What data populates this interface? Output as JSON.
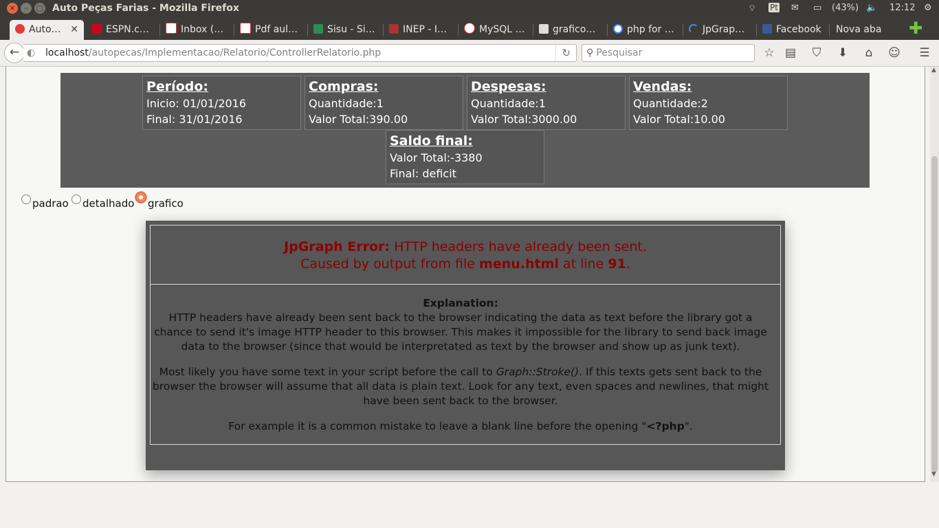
{
  "os": {
    "window_title": "Auto Peças Farias - Mozilla Firefox",
    "keyboard": "Pt",
    "battery": "(43%)",
    "clock": "12:12"
  },
  "tabs": [
    {
      "label": "Auto…",
      "active": true,
      "icon": "autopecas-favicon"
    },
    {
      "label": "ESPN.c…",
      "icon": "espn-favicon"
    },
    {
      "label": "Inbox (…",
      "icon": "gmail-icon"
    },
    {
      "label": "Pdf aul…",
      "icon": "gmail-icon"
    },
    {
      "label": "Sisu - Si…",
      "icon": "sisu-favicon"
    },
    {
      "label": "INEP - I…",
      "icon": "inep-favicon"
    },
    {
      "label": "MySQL …",
      "icon": "mysql-favicon"
    },
    {
      "label": "grafico…",
      "icon": "chart-favicon"
    },
    {
      "label": "php for …",
      "icon": "google-icon"
    },
    {
      "label": "JpGrap…",
      "icon": "loading-icon"
    },
    {
      "label": "Facebook",
      "icon": "facebook-icon"
    },
    {
      "label": "Nova aba",
      "icon": ""
    }
  ],
  "nav": {
    "url_host": "localhost",
    "url_path": "/autopecas/Implementacao/Relatorio/ControllerRelatorio.php",
    "search_placeholder": "Pesquisar"
  },
  "summary": {
    "periodo": {
      "title": "Período:",
      "line1": "Inicio: 01/01/2016",
      "line2": "Final: 31/01/2016"
    },
    "compras": {
      "title": "Compras:",
      "line1": "Quantidade:1",
      "line2": "Valor Total:390.00"
    },
    "despesas": {
      "title": "Despesas:",
      "line1": "Quantidade:1",
      "line2": "Valor Total:3000.00"
    },
    "vendas": {
      "title": "Vendas:",
      "line1": "Quantidade:2",
      "line2": "Valor Total:10.00"
    },
    "saldo": {
      "title": "Saldo final:",
      "line1": "Valor Total:-3380",
      "line2": "Final: deficit"
    }
  },
  "report_type": {
    "options": [
      "padrao",
      "detalhado",
      "grafico"
    ],
    "selected": "grafico"
  },
  "error": {
    "prefix": "JpGraph Error:",
    "message": "HTTP headers have already been sent.",
    "cause_pre": "Caused by output from file",
    "file": "menu.html",
    "cause_mid": "at line",
    "line": "91",
    "cause_end": ".",
    "explanation_title": "Explanation:",
    "p1": "HTTP headers have already been sent back to the browser indicating the data as text before the library got a chance to send it's image HTTP header to this browser. This makes it impossible for the library to send back image data to the browser (since that would be interpretated as text by the browser and show up as junk text).",
    "p2_pre": "Most likely you have some text in your script before the call to",
    "p2_code": "Graph::Stroke()",
    "p2_post": ". If this texts gets sent back to the browser the browser will assume that all data is plain text. Look for any text, even spaces and newlines, that might have been sent back to the browser.",
    "p3_pre": "For example it is a common mistake to leave a blank line before the opening \"",
    "p3_code": "<?php",
    "p3_post": "\"."
  }
}
